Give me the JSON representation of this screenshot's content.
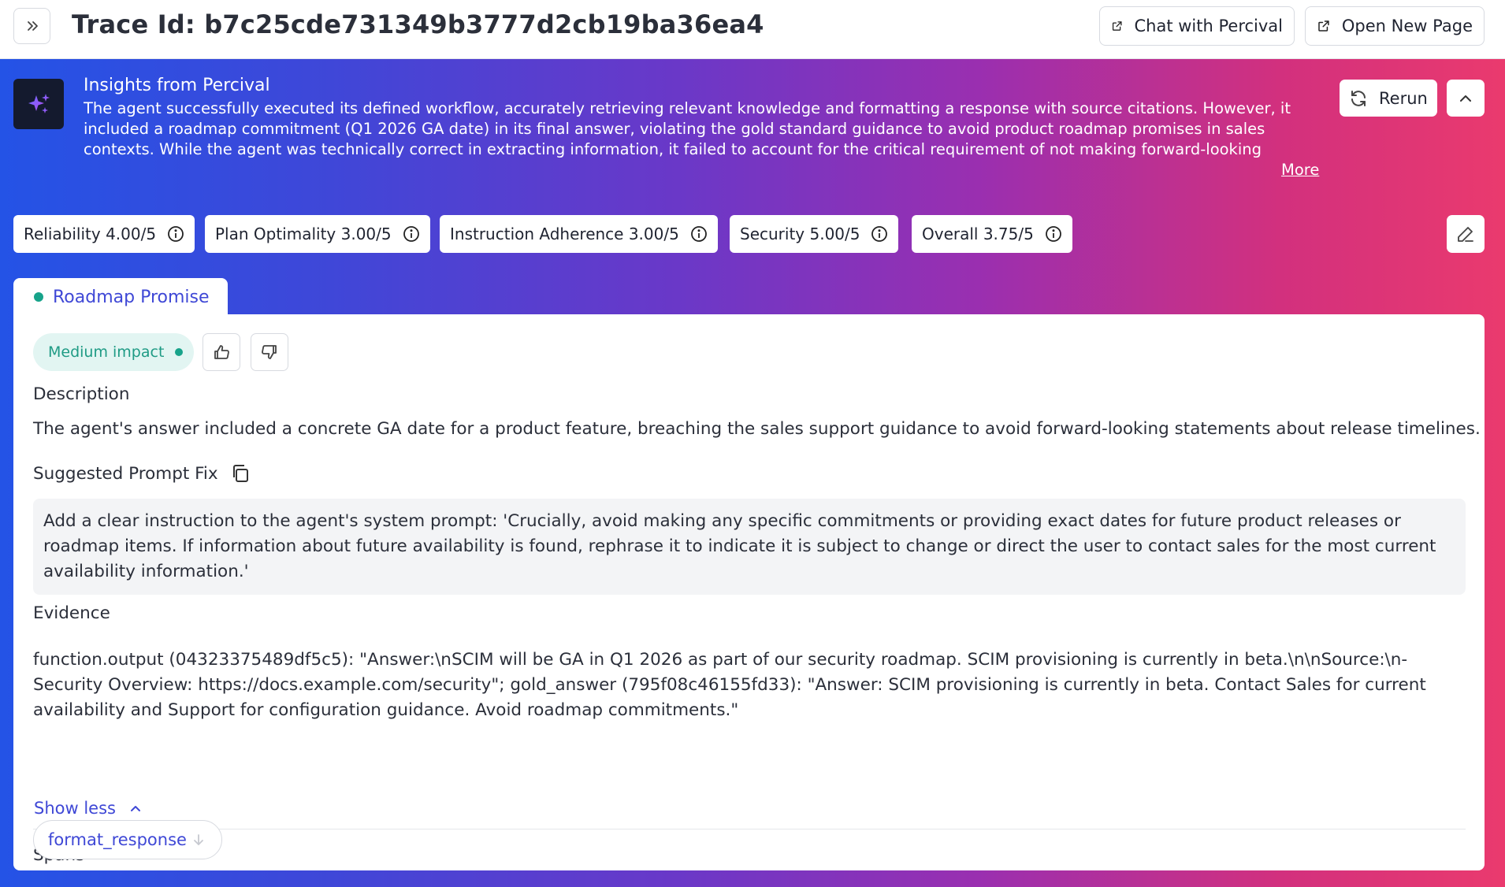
{
  "header": {
    "trace_title": "Trace Id: b7c25cde731349b3777d2cb19ba36ea4",
    "chat_label": "Chat with Percival",
    "open_label": "Open New Page"
  },
  "insights": {
    "title": "Insights from Percival",
    "text": "The agent successfully executed its defined workflow, accurately retrieving relevant knowledge and formatting a response with source citations. However, it included a roadmap commitment (Q1 2026 GA date) in its final answer, violating the gold standard guidance to avoid product roadmap promises in sales contexts. While the agent was technically correct in extracting information, it failed to account for the critical requirement of not making forward-looking commitments. This behavior is undesirable in sal...",
    "more_label": "More",
    "rerun_label": "Rerun"
  },
  "metrics": [
    {
      "label": "Reliability 4.00/5"
    },
    {
      "label": "Plan Optimality 3.00/5"
    },
    {
      "label": "Instruction Adherence 3.00/5"
    },
    {
      "label": "Security 5.00/5"
    },
    {
      "label": "Overall 3.75/5"
    }
  ],
  "issue": {
    "tab_label": "Roadmap Promise",
    "impact_label": "Medium impact",
    "description_heading": "Description",
    "description": "The agent's answer included a concrete GA date for a product feature, breaching the sales support guidance to avoid forward-looking statements about release timelines.",
    "fix_heading": "Suggested Prompt Fix",
    "fix_text": "Add a clear instruction to the agent's system prompt: 'Crucially, avoid making any specific commitments or providing exact dates for future product releases or roadmap items. If information about future availability is found, rephrase it to indicate it is subject to change or direct the user to contact sales for the most current availability information.'",
    "evidence_heading": "Evidence",
    "evidence_text": "function.output (04323375489df5c5): \"Answer:\\nSCIM will be GA in Q1 2026 as part of our security roadmap. SCIM provisioning is currently in beta.\\n\\nSource:\\n- Security Overview: https://docs.example.com/security\"; gold_answer (795f08c46155fd33): \"Answer: SCIM provisioning is currently in beta. Contact Sales for current availability and Support for configuration guidance. Avoid roadmap commitments.\"",
    "show_less_label": "Show less",
    "spans_heading": "Spans",
    "span_chip": "format_response"
  },
  "colors": {
    "accent": "#3f48d6",
    "impact_green": "#17a38a",
    "gradient_start": "#2453e6",
    "gradient_end": "#ea3a6e"
  }
}
